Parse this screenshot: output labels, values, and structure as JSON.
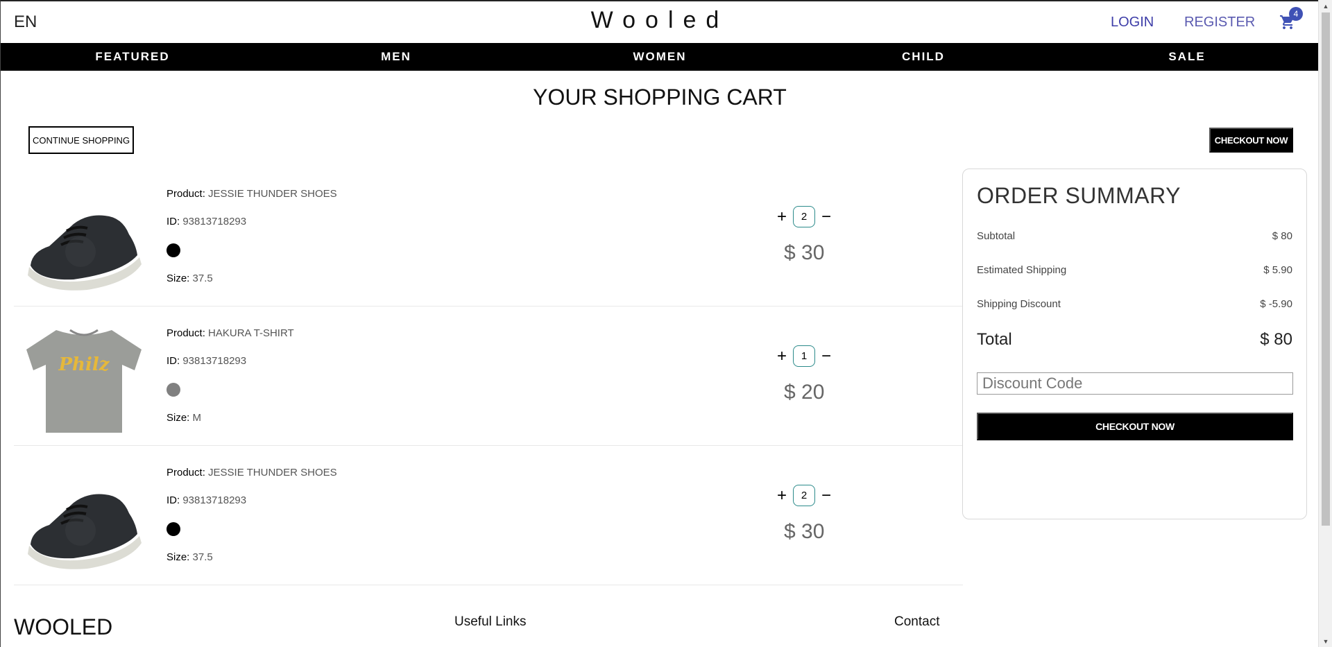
{
  "header": {
    "lang": "EN",
    "logo": "Wooled",
    "login": "LOGIN",
    "register": "REGISTER",
    "cart_count": "4"
  },
  "nav": {
    "items": [
      "FEATURED",
      "MEN",
      "WOMEN",
      "CHILD",
      "SALE"
    ]
  },
  "page": {
    "title": "YOUR SHOPPING CART",
    "continue_label": "CONTINUE SHOPPING",
    "checkout_label": "CHECKOUT NOW"
  },
  "cart": {
    "items": [
      {
        "product_label": "Product:",
        "product": "JESSIE THUNDER SHOES",
        "id_label": "ID:",
        "id": "93813718293",
        "color": "#000000",
        "size_label": "Size:",
        "size": "37.5",
        "qty": "2",
        "price": "$ 30",
        "image": "shoe"
      },
      {
        "product_label": "Product:",
        "product": "HAKURA T-SHIRT",
        "id_label": "ID:",
        "id": "93813718293",
        "color": "#808080",
        "size_label": "Size:",
        "size": "M",
        "qty": "1",
        "price": "$ 20",
        "image": "tshirt"
      },
      {
        "product_label": "Product:",
        "product": "JESSIE THUNDER SHOES",
        "id_label": "ID:",
        "id": "93813718293",
        "color": "#000000",
        "size_label": "Size:",
        "size": "37.5",
        "qty": "2",
        "price": "$ 30",
        "image": "shoe"
      }
    ],
    "plus_icon": "+",
    "minus_icon": "−"
  },
  "summary": {
    "title": "ORDER SUMMARY",
    "subtotal_label": "Subtotal",
    "subtotal": "$ 80",
    "shipping_label": "Estimated Shipping",
    "shipping": "$ 5.90",
    "discount_label": "Shipping Discount",
    "discount": "$ -5.90",
    "total_label": "Total",
    "total": "$ 80",
    "code_placeholder": "Discount Code",
    "checkout_label": "CHECKOUT NOW"
  },
  "tshirt_text": "Philz",
  "footer": {
    "logo": "WOOLED",
    "links": "Useful Links",
    "contact": "Contact"
  },
  "colors": {
    "accent": "#3f51b5",
    "link": "#3d3da8"
  }
}
